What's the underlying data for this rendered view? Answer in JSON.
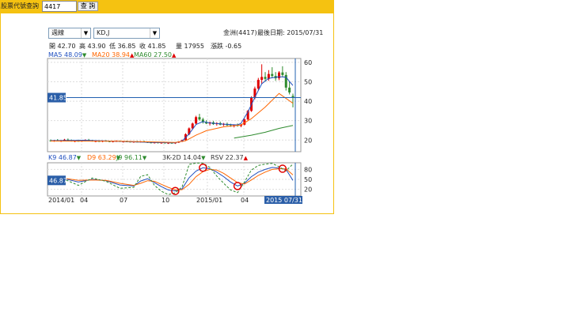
{
  "query": {
    "label": "股票代號查詢",
    "value": "4417",
    "button": "查 詢"
  },
  "controls": {
    "period": "週線",
    "indicator": "KD,J"
  },
  "header": {
    "stock": "金洲(4417)",
    "last_date": "最後日期: 2015/07/31"
  },
  "ohlc": [
    {
      "key": "開",
      "value": "42.70"
    },
    {
      "key": "高",
      "value": "43.90"
    },
    {
      "key": "低",
      "value": "36.85"
    },
    {
      "key": "收",
      "value": "41.85"
    },
    {
      "key": "量",
      "value": "17955"
    },
    {
      "key": "漲跌",
      "value": "-0.65"
    }
  ],
  "ma_legend": [
    {
      "label": "MA5 48.09",
      "arrow": "▼",
      "color": "#1f4fbf",
      "arrow_color": "#2e8b2e"
    },
    {
      "label": "MA20 38.94",
      "arrow": "▲",
      "color": "#ff6600",
      "arrow_color": "#e00000"
    },
    {
      "label": "MA60 27.50",
      "arrow": "▲",
      "color": "#2e8b2e",
      "arrow_color": "#e00000"
    }
  ],
  "kd_legend": [
    {
      "label": "K9 46.87",
      "arrow": "▼",
      "color": "#1f4fbf",
      "arrow_color": "#2e8b2e"
    },
    {
      "label": "D9 63.29",
      "arrow": "▼",
      "color": "#ff6600",
      "arrow_color": "#2e8b2e"
    },
    {
      "label": "J9 96.11",
      "arrow": "▼",
      "color": "#2e8b2e",
      "arrow_color": "#2e8b2e"
    },
    {
      "label": "3K-2D 14.04",
      "arrow": "▼",
      "color": "#333333",
      "arrow_color": "#2e8b2e"
    },
    {
      "label": "RSV 22.37",
      "arrow": "▲",
      "color": "#333333",
      "arrow_color": "#e00000"
    }
  ],
  "chart_data": [
    {
      "type": "candlestick",
      "price_marker": "41.85",
      "ylim": [
        14,
        62
      ],
      "y_ticks": [
        "60",
        "50",
        "40",
        "30",
        "20"
      ],
      "x_ticks": [
        "2014/01",
        "04",
        "07",
        "10",
        "2015/01",
        "04",
        "2015 07/31"
      ],
      "colors": {
        "up": "#e00000",
        "down": "#2e8b2e"
      },
      "candles": [
        {
          "o": 19.8,
          "h": 20.3,
          "l": 19.2,
          "c": 19.6
        },
        {
          "o": 19.6,
          "h": 20.1,
          "l": 19.1,
          "c": 19.9
        },
        {
          "o": 19.9,
          "h": 20.5,
          "l": 19.4,
          "c": 19.5
        },
        {
          "o": 19.5,
          "h": 20.0,
          "l": 19.0,
          "c": 19.8
        },
        {
          "o": 19.8,
          "h": 20.6,
          "l": 19.5,
          "c": 20.2
        },
        {
          "o": 20.2,
          "h": 20.8,
          "l": 19.7,
          "c": 19.9
        },
        {
          "o": 19.9,
          "h": 20.3,
          "l": 19.2,
          "c": 19.4
        },
        {
          "o": 19.4,
          "h": 19.9,
          "l": 18.9,
          "c": 19.6
        },
        {
          "o": 19.6,
          "h": 20.2,
          "l": 19.2,
          "c": 19.5
        },
        {
          "o": 19.5,
          "h": 20.0,
          "l": 19.1,
          "c": 19.8
        },
        {
          "o": 19.8,
          "h": 20.4,
          "l": 19.5,
          "c": 20.1
        },
        {
          "o": 20.1,
          "h": 20.6,
          "l": 19.6,
          "c": 19.7
        },
        {
          "o": 19.7,
          "h": 20.1,
          "l": 19.2,
          "c": 19.4
        },
        {
          "o": 19.4,
          "h": 19.8,
          "l": 18.9,
          "c": 19.5
        },
        {
          "o": 19.5,
          "h": 19.9,
          "l": 19.0,
          "c": 19.3
        },
        {
          "o": 19.3,
          "h": 19.8,
          "l": 18.9,
          "c": 19.6
        },
        {
          "o": 19.6,
          "h": 20.0,
          "l": 19.2,
          "c": 19.4
        },
        {
          "o": 19.4,
          "h": 19.7,
          "l": 18.9,
          "c": 19.2
        },
        {
          "o": 19.2,
          "h": 19.6,
          "l": 18.8,
          "c": 19.4
        },
        {
          "o": 19.4,
          "h": 19.9,
          "l": 19.0,
          "c": 19.5
        },
        {
          "o": 19.5,
          "h": 19.8,
          "l": 19.0,
          "c": 19.1
        },
        {
          "o": 19.1,
          "h": 19.5,
          "l": 18.7,
          "c": 19.3
        },
        {
          "o": 19.3,
          "h": 19.7,
          "l": 18.9,
          "c": 19.2
        },
        {
          "o": 19.2,
          "h": 19.5,
          "l": 18.8,
          "c": 19.0
        },
        {
          "o": 19.0,
          "h": 19.4,
          "l": 18.6,
          "c": 19.2
        },
        {
          "o": 19.2,
          "h": 19.6,
          "l": 18.8,
          "c": 19.1
        },
        {
          "o": 19.1,
          "h": 19.5,
          "l": 18.7,
          "c": 19.3
        },
        {
          "o": 19.3,
          "h": 19.7,
          "l": 18.9,
          "c": 19.0
        },
        {
          "o": 19.0,
          "h": 19.3,
          "l": 18.5,
          "c": 18.8
        },
        {
          "o": 18.8,
          "h": 19.2,
          "l": 18.3,
          "c": 18.6
        },
        {
          "o": 18.6,
          "h": 19.0,
          "l": 18.2,
          "c": 18.8
        },
        {
          "o": 18.8,
          "h": 19.1,
          "l": 18.3,
          "c": 18.5
        },
        {
          "o": 18.5,
          "h": 18.9,
          "l": 18.1,
          "c": 18.7
        },
        {
          "o": 18.7,
          "h": 19.0,
          "l": 18.2,
          "c": 18.4
        },
        {
          "o": 18.4,
          "h": 18.8,
          "l": 18.0,
          "c": 18.6
        },
        {
          "o": 18.6,
          "h": 18.9,
          "l": 18.1,
          "c": 18.5
        },
        {
          "o": 18.5,
          "h": 18.8,
          "l": 18.0,
          "c": 18.7
        },
        {
          "o": 18.7,
          "h": 19.4,
          "l": 18.5,
          "c": 19.2
        },
        {
          "o": 19.2,
          "h": 20.2,
          "l": 19.0,
          "c": 20.0
        },
        {
          "o": 20.0,
          "h": 23.5,
          "l": 19.8,
          "c": 23.0
        },
        {
          "o": 23.0,
          "h": 26.5,
          "l": 22.5,
          "c": 26.0
        },
        {
          "o": 26.0,
          "h": 29.0,
          "l": 25.5,
          "c": 28.5
        },
        {
          "o": 28.5,
          "h": 32.5,
          "l": 28.0,
          "c": 31.8
        },
        {
          "o": 31.8,
          "h": 33.5,
          "l": 30.0,
          "c": 30.6
        },
        {
          "o": 30.6,
          "h": 31.5,
          "l": 28.5,
          "c": 29.2
        },
        {
          "o": 29.2,
          "h": 30.2,
          "l": 28.2,
          "c": 28.5
        },
        {
          "o": 28.5,
          "h": 29.5,
          "l": 27.5,
          "c": 29.1
        },
        {
          "o": 29.1,
          "h": 29.8,
          "l": 27.8,
          "c": 28.2
        },
        {
          "o": 28.2,
          "h": 29.2,
          "l": 27.4,
          "c": 28.7
        },
        {
          "o": 28.7,
          "h": 29.5,
          "l": 27.6,
          "c": 27.9
        },
        {
          "o": 27.9,
          "h": 28.8,
          "l": 27.2,
          "c": 28.3
        },
        {
          "o": 28.3,
          "h": 29.0,
          "l": 27.3,
          "c": 27.6
        },
        {
          "o": 27.6,
          "h": 28.4,
          "l": 26.8,
          "c": 27.2
        },
        {
          "o": 27.2,
          "h": 28.0,
          "l": 26.5,
          "c": 27.8
        },
        {
          "o": 27.8,
          "h": 28.5,
          "l": 26.9,
          "c": 27.3
        },
        {
          "o": 27.3,
          "h": 28.2,
          "l": 26.6,
          "c": 27.9
        },
        {
          "o": 27.9,
          "h": 31.0,
          "l": 27.6,
          "c": 30.6
        },
        {
          "o": 30.6,
          "h": 35.5,
          "l": 30.2,
          "c": 35.0
        },
        {
          "o": 35.0,
          "h": 42.5,
          "l": 34.5,
          "c": 41.8
        },
        {
          "o": 41.8,
          "h": 47.5,
          "l": 41.0,
          "c": 46.5
        },
        {
          "o": 46.5,
          "h": 52.0,
          "l": 45.5,
          "c": 51.0
        },
        {
          "o": 51.0,
          "h": 59.0,
          "l": 49.0,
          "c": 52.5
        },
        {
          "o": 52.5,
          "h": 55.0,
          "l": 50.0,
          "c": 51.5
        },
        {
          "o": 51.5,
          "h": 56.0,
          "l": 50.5,
          "c": 54.0
        },
        {
          "o": 54.0,
          "h": 57.5,
          "l": 52.0,
          "c": 53.0
        },
        {
          "o": 53.0,
          "h": 55.0,
          "l": 50.5,
          "c": 51.8
        },
        {
          "o": 51.8,
          "h": 55.5,
          "l": 50.8,
          "c": 54.8
        },
        {
          "o": 54.8,
          "h": 58.0,
          "l": 52.5,
          "c": 53.5
        },
        {
          "o": 53.5,
          "h": 55.0,
          "l": 45.5,
          "c": 47.0
        },
        {
          "o": 47.0,
          "h": 50.0,
          "l": 43.5,
          "c": 44.5
        },
        {
          "o": 42.7,
          "h": 43.9,
          "l": 36.85,
          "c": 41.85
        }
      ],
      "ma_series": [
        {
          "name": "MA5",
          "color": "#1f4fbf",
          "points": [
            [
              0,
              19.7
            ],
            [
              10,
              19.9
            ],
            [
              20,
              19.3
            ],
            [
              30,
              18.7
            ],
            [
              36,
              18.6
            ],
            [
              38,
              19.5
            ],
            [
              40,
              23.2
            ],
            [
              42,
              28.0
            ],
            [
              44,
              29.5
            ],
            [
              46,
              28.8
            ],
            [
              50,
              28.2
            ],
            [
              54,
              27.8
            ],
            [
              55,
              28.6
            ],
            [
              57,
              34.5
            ],
            [
              59,
              42.0
            ],
            [
              61,
              49.0
            ],
            [
              63,
              51.8
            ],
            [
              66,
              52.6
            ],
            [
              68,
              52.4
            ],
            [
              69,
              50.2
            ],
            [
              70,
              48.09
            ]
          ]
        },
        {
          "name": "MA20",
          "color": "#ff6600",
          "points": [
            [
              0,
              19.5
            ],
            [
              20,
              19.4
            ],
            [
              36,
              18.8
            ],
            [
              39,
              19.6
            ],
            [
              42,
              22.5
            ],
            [
              45,
              24.8
            ],
            [
              50,
              26.8
            ],
            [
              55,
              27.8
            ],
            [
              58,
              31.0
            ],
            [
              62,
              37.0
            ],
            [
              66,
              44.0
            ],
            [
              70,
              38.94
            ]
          ]
        },
        {
          "name": "MA60",
          "color": "#2e8b2e",
          "points": [
            [
              53,
              21.0
            ],
            [
              58,
              22.5
            ],
            [
              62,
              24.0
            ],
            [
              66,
              26.0
            ],
            [
              70,
              27.5
            ]
          ]
        }
      ]
    },
    {
      "type": "line",
      "price_marker": "46.87",
      "ylim": [
        0,
        100
      ],
      "y_ticks": [
        "80",
        "50",
        "20"
      ],
      "series": [
        {
          "name": "K9",
          "color": "#1f4fbf",
          "points": [
            [
              0,
              55
            ],
            [
              4,
              52
            ],
            [
              8,
              42
            ],
            [
              12,
              50
            ],
            [
              16,
              46
            ],
            [
              20,
              33
            ],
            [
              24,
              30
            ],
            [
              26,
              45
            ],
            [
              28,
              52
            ],
            [
              30,
              40
            ],
            [
              32,
              28
            ],
            [
              34,
              18
            ],
            [
              36,
              15
            ],
            [
              38,
              22
            ],
            [
              40,
              55
            ],
            [
              42,
              75
            ],
            [
              44,
              85
            ],
            [
              46,
              82
            ],
            [
              48,
              72
            ],
            [
              50,
              58
            ],
            [
              52,
              42
            ],
            [
              54,
              30
            ],
            [
              56,
              38
            ],
            [
              58,
              58
            ],
            [
              60,
              72
            ],
            [
              62,
              80
            ],
            [
              64,
              86
            ],
            [
              66,
              84
            ],
            [
              68,
              80
            ],
            [
              70,
              46.87
            ]
          ]
        },
        {
          "name": "D9",
          "color": "#ff6600",
          "points": [
            [
              0,
              54
            ],
            [
              4,
              53
            ],
            [
              8,
              47
            ],
            [
              12,
              48
            ],
            [
              16,
              47
            ],
            [
              20,
              38
            ],
            [
              24,
              32
            ],
            [
              26,
              38
            ],
            [
              28,
              46
            ],
            [
              30,
              44
            ],
            [
              32,
              35
            ],
            [
              34,
              26
            ],
            [
              36,
              18
            ],
            [
              38,
              19
            ],
            [
              40,
              35
            ],
            [
              42,
              58
            ],
            [
              44,
              73
            ],
            [
              46,
              80
            ],
            [
              48,
              78
            ],
            [
              50,
              68
            ],
            [
              52,
              54
            ],
            [
              54,
              40
            ],
            [
              56,
              36
            ],
            [
              58,
              48
            ],
            [
              60,
              62
            ],
            [
              62,
              72
            ],
            [
              64,
              80
            ],
            [
              66,
              82
            ],
            [
              68,
              82
            ],
            [
              70,
              63.29
            ]
          ]
        },
        {
          "name": "J9",
          "color": "#2e8b2e",
          "points": [
            [
              0,
              57
            ],
            [
              4,
              50
            ],
            [
              8,
              32
            ],
            [
              12,
              54
            ],
            [
              16,
              44
            ],
            [
              20,
              23
            ],
            [
              24,
              26
            ],
            [
              26,
              59
            ],
            [
              28,
              64
            ],
            [
              30,
              32
            ],
            [
              32,
              14
            ],
            [
              34,
              4
            ],
            [
              36,
              9
            ],
            [
              38,
              28
            ],
            [
              40,
              95
            ],
            [
              42,
              99
            ],
            [
              44,
              99
            ],
            [
              46,
              86
            ],
            [
              48,
              60
            ],
            [
              50,
              38
            ],
            [
              52,
              18
            ],
            [
              54,
              10
            ],
            [
              56,
              42
            ],
            [
              58,
              78
            ],
            [
              60,
              92
            ],
            [
              62,
              96
            ],
            [
              64,
              98
            ],
            [
              66,
              88
            ],
            [
              68,
              76
            ],
            [
              70,
              96.11
            ]
          ]
        }
      ],
      "markers": [
        [
          36,
          15
        ],
        [
          44,
          85
        ],
        [
          54,
          30
        ],
        [
          67,
          82
        ]
      ]
    }
  ]
}
